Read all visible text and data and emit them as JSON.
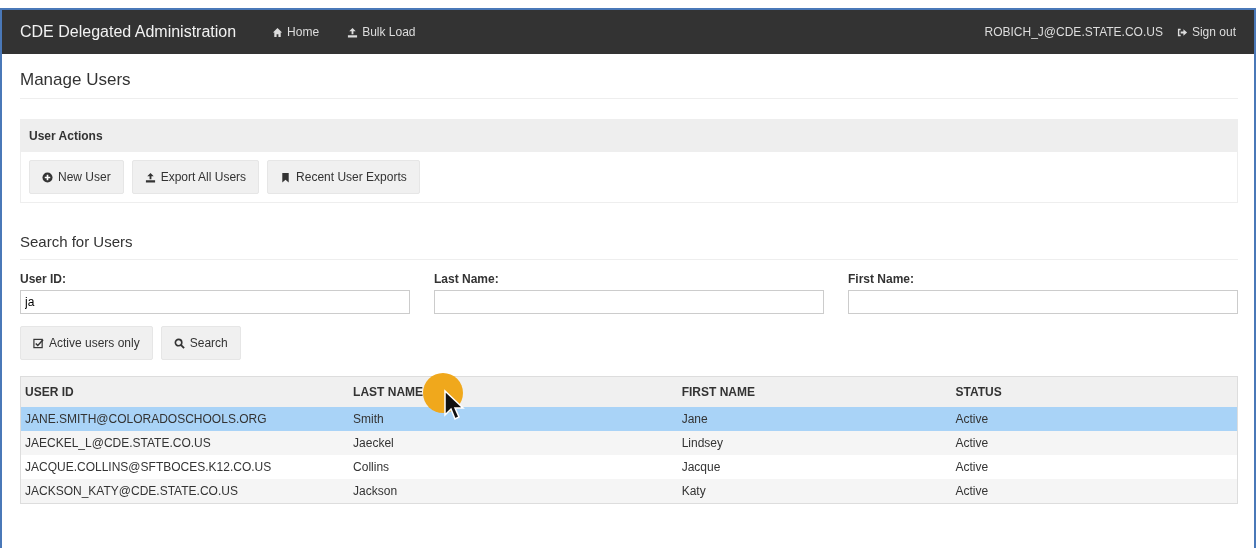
{
  "navbar": {
    "brand": "CDE Delegated Administration",
    "links": [
      {
        "label": "Home"
      },
      {
        "label": "Bulk Load"
      }
    ],
    "user": "ROBICH_J@CDE.STATE.CO.US",
    "signout": "Sign out"
  },
  "page_title": "Manage Users",
  "user_actions": {
    "heading": "User Actions",
    "buttons": [
      {
        "label": "New User"
      },
      {
        "label": "Export All Users"
      },
      {
        "label": "Recent User Exports"
      }
    ]
  },
  "search": {
    "heading": "Search for Users",
    "fields": [
      {
        "label": "User ID:",
        "value": "ja"
      },
      {
        "label": "Last Name:"
      },
      {
        "label": "First Name:"
      }
    ],
    "active_only": {
      "label": "Active users only",
      "checked": true
    },
    "search_button": "Search"
  },
  "table": {
    "columns": [
      "USER ID",
      "LAST NAME",
      "FIRST NAME",
      "STATUS"
    ],
    "rows": [
      {
        "cells": [
          "JANE.SMITH@COLORADOSCHOOLS.ORG",
          "Smith",
          "Jane",
          "Active"
        ],
        "selected": true
      },
      {
        "cells": [
          "JAECKEL_L@CDE.STATE.CO.US",
          "Jaeckel",
          "Lindsey",
          "Active"
        ],
        "selected": false
      },
      {
        "cells": [
          "JACQUE.COLLINS@SFTBOCES.K12.CO.US",
          "Collins",
          "Jacque",
          "Active"
        ],
        "selected": false
      },
      {
        "cells": [
          "JACKSON_KATY@CDE.STATE.CO.US",
          "Jackson",
          "Katy",
          "Active"
        ],
        "selected": false
      }
    ]
  }
}
